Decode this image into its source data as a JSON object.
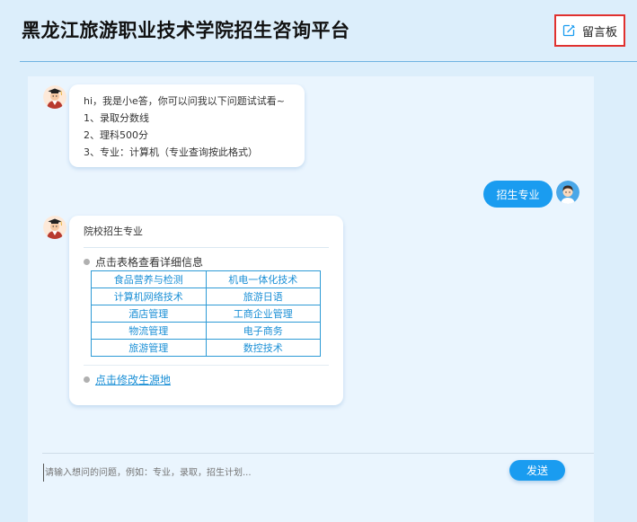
{
  "header": {
    "title": "黑龙江旅游职业技术学院招生咨询平台",
    "message_board_label": "留言板",
    "message_board_icon": "edit-icon"
  },
  "chat": {
    "bot_avatar_icon": "graduate-avatar",
    "user_avatar_icon": "user-avatar",
    "welcome_message": {
      "lines": [
        "hi，我是小e答，你可以问我以下问题试试看~",
        "1、录取分数线",
        "2、理科500分",
        "3、专业：计算机（专业查询按此格式）"
      ]
    },
    "user_message": "招生专业",
    "majors_reply": {
      "title": "院校招生专业",
      "hint": "点击表格查看详细信息",
      "majors": [
        [
          "食品营养与检测",
          "机电一体化技术"
        ],
        [
          "计算机网络技术",
          "旅游日语"
        ],
        [
          "酒店管理",
          "工商企业管理"
        ],
        [
          "物流管理",
          "电子商务"
        ],
        [
          "旅游管理",
          "数控技术"
        ]
      ],
      "edit_link": "点击修改生源地"
    }
  },
  "input": {
    "placeholder": "请输入想问的问题，例如：专业，录取，招生计划...",
    "value": "",
    "send_label": "发送"
  },
  "colors": {
    "accent": "#1a9cf0",
    "highlight_border": "#e0312f",
    "page_background": "#dceefb"
  }
}
